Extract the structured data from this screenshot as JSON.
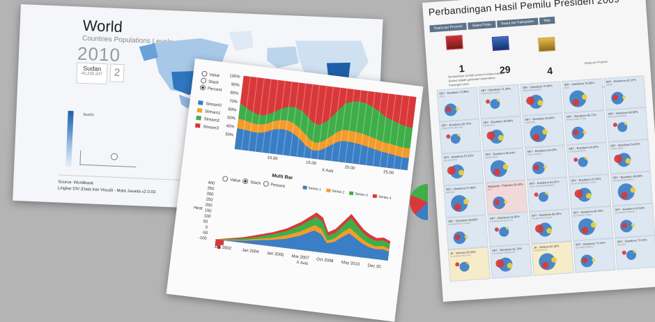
{
  "world": {
    "title": "World",
    "subtitle": "Countries Populations Levels",
    "year": "2010",
    "country": "Sudan",
    "country_value": "41,230,247",
    "rank": "2",
    "legend_label": "levels",
    "footer_source": "Source: Worldbank",
    "footer_credit": "Lingkar DIV (Data Into Visual) - Mata Javada v2.0.03"
  },
  "stream": {
    "modes": [
      "Value",
      "Stack",
      "Percent"
    ],
    "selected_mode": "Percent",
    "series": [
      "Stream0",
      "Stream1",
      "Stream2",
      "Stream3"
    ],
    "colors": {
      "Stream0": "#3a7ec6",
      "Stream1": "#f39c2b",
      "Stream2": "#3fae49",
      "Stream3": "#d9383a"
    },
    "y_ticks": [
      "100%",
      "90%",
      "80%",
      "70%",
      "60%",
      "50%",
      "40%",
      "30%"
    ],
    "x_ticks": [
      "10.00",
      "15.00",
      "20.00",
      "25.00"
    ],
    "x_label": "X Axis",
    "y_label": "Y Axis"
  },
  "multibar": {
    "title": "Multi Bar",
    "modes": [
      "Value",
      "Stack",
      "Percent"
    ],
    "selected_mode": "Stack",
    "series": [
      "Series 1",
      "Series 2",
      "Series 3",
      "Series 4"
    ],
    "colors": {
      "Series 1": "#3a7ec6",
      "Series 2": "#f39c2b",
      "Series 3": "#3fae49",
      "Series 4": "#d9383a"
    },
    "y_ticks": [
      "400",
      "350",
      "300",
      "250",
      "200",
      "150",
      "100",
      "50",
      "0",
      "-50",
      "-100"
    ],
    "x_ticks": [
      "Jan 2002",
      "Jan 2004",
      "Jan 2005",
      "Mar 2007",
      "Oct 2008",
      "May 2010",
      "Dec 20"
    ],
    "x_label": "X Axis",
    "y_label": "Heat"
  },
  "election": {
    "title": "Perbandingan Hasil Pemilu Presiden 2009",
    "nav": [
      "Suara per Provinsi",
      "Suara Pulau",
      "Suara per Kabupaten",
      "Map"
    ],
    "stats": [
      {
        "value": "1"
      },
      {
        "value": "29"
      },
      {
        "value": "4"
      }
    ],
    "stat_desc": "Berdasarkan Jumlah suara di setiap propinsi. Berikut adalah gambaran kepemilikan Pasangan calon",
    "right_label": "Suara per Propinsi",
    "cells": [
      {
        "label": "SBY - Boediono 73.88%",
        "sub": "ACEH",
        "tone": "blue"
      },
      {
        "label": "SBY - Boediono 71.49%",
        "sub": "SUMATERA UTARA",
        "tone": "blue"
      },
      {
        "label": "SBY - Boediono 70.00%",
        "sub": "SUMATERA BARAT",
        "tone": "blue"
      },
      {
        "label": "SBY - Boediono 70.58%",
        "sub": "RIAU",
        "tone": "blue"
      },
      {
        "label": "SBY - Boediono 62.22%",
        "sub": "JAMBI",
        "tone": "blue"
      },
      {
        "label": "SBY - Boediono 60.76%",
        "sub": "SUMATERA SELATAN",
        "tone": "blue"
      },
      {
        "label": "SBY - Boediono 60.98%",
        "sub": "BENGKULU",
        "tone": "blue"
      },
      {
        "label": "SBY - Boediono 62.55%",
        "sub": "LAMPUNG",
        "tone": "blue"
      },
      {
        "label": "SBY - Boediono 65.71%",
        "sub": "BANGKA BELITUNG",
        "tone": "blue"
      },
      {
        "label": "SBY - Boediono 68.80%",
        "sub": "KEPULAUAN RIAU",
        "tone": "blue"
      },
      {
        "label": "SBY - Boediono 57.62%",
        "sub": "DKI JAKARTA",
        "tone": "blue"
      },
      {
        "label": "SBY - Boediono 50.64%",
        "sub": "JAWA BARAT",
        "tone": "blue"
      },
      {
        "label": "SBY - Boediono 51.69%",
        "sub": "JAWA TENGAH",
        "tone": "blue"
      },
      {
        "label": "SBY - Boediono 54.84%",
        "sub": "DI YOGYAKARTA",
        "tone": "blue"
      },
      {
        "label": "SBY - Boediono 54.81%",
        "sub": "JAWA TIMUR",
        "tone": "blue"
      },
      {
        "label": "SBY - Boediono 57.85%",
        "sub": "BANTEN",
        "tone": "blue"
      },
      {
        "label": "Megawati - Prabowo 58.43%",
        "sub": "BALI",
        "tone": "pink"
      },
      {
        "label": "SBY - Boediono 61.81%",
        "sub": "NUSA TENGGARA BARAT",
        "tone": "blue"
      },
      {
        "label": "SBY - Boediono 67.96%",
        "sub": "NUSA TENGGARA TIMUR",
        "tone": "blue"
      },
      {
        "label": "SBY - Boediono 66.88%",
        "sub": "KALIMANTAN BARAT",
        "tone": "blue"
      },
      {
        "label": "SBY - Boediono 65.58%",
        "sub": "KALIMANTAN TENGAH",
        "tone": "blue"
      },
      {
        "label": "SBY - Boediono 61.60%",
        "sub": "KALIMANTAN SELATAN",
        "tone": "blue"
      },
      {
        "label": "SBY - Boediono 65.90%",
        "sub": "KALIMANTAN TIMUR",
        "tone": "blue"
      },
      {
        "label": "SBY - Boediono 66.49%",
        "sub": "SULAWESI UTARA",
        "tone": "blue"
      },
      {
        "label": "SBY - Boediono 62.52%",
        "sub": "SULAWESI TENGAH",
        "tone": "blue"
      },
      {
        "label": "JK - Wiranto 55.33%",
        "sub": "SULAWESI SELATAN",
        "tone": "yellow"
      },
      {
        "label": "SBY - Boediono 51.13%",
        "sub": "SULAWESI TENGGARA",
        "tone": "blue"
      },
      {
        "label": "JK - Wiranto 62.36%",
        "sub": "GORONTALO",
        "tone": "yellow"
      },
      {
        "label": "SBY - Boediono 74.10%",
        "sub": "SULAWESI BARAT",
        "tone": "blue"
      },
      {
        "label": "SBY - Boediono 72.02%",
        "sub": "MALUKU",
        "tone": "blue"
      }
    ]
  }
}
